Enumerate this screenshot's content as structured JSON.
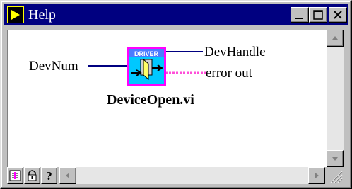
{
  "window": {
    "title": "Help"
  },
  "diagram": {
    "input_label": "DevNum",
    "output_label_1": "DevHandle",
    "output_label_2": "error out",
    "node_badge": "DRIVER",
    "vi_name": "DeviceOpen.vi"
  },
  "icons": {
    "title": "labview-run-arrow-icon",
    "minimize": "minimize-icon",
    "maximize": "maximize-icon",
    "close": "close-icon",
    "bottom_1": "block-diagram-icon",
    "bottom_2": "lock-icon",
    "bottom_3": "question-mark-icon"
  },
  "colors": {
    "title_bar": "#000080",
    "node_fill": "#00c8ff",
    "node_border": "#ff00ff",
    "wire_1": "#000080",
    "wire_2": "#ff4fd8"
  }
}
